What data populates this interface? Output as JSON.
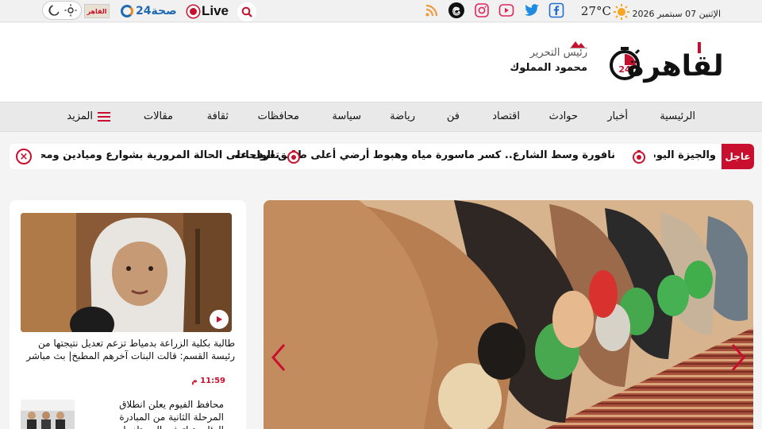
{
  "topbar": {
    "date": "الإثنين 07 سبتمبر 2026",
    "temperature": "27°C",
    "live_label": "Live",
    "sehha_label": "صحة24",
    "mini_logo_text": "القاهر"
  },
  "header": {
    "editor_title": "رئيس التحرير",
    "editor_name": "محمود المملوك",
    "logo_text": "القاهرة",
    "logo_number": "24"
  },
  "nav": {
    "items": [
      "الرئيسية",
      "أخبار",
      "حوادث",
      "اقتصاد",
      "فن",
      "رياضة",
      "سياسة",
      "محافظات",
      "ثقافة",
      "مقالات"
    ],
    "more_label": "المزيد"
  },
  "ticker": {
    "breaking_label": "عاجل",
    "items": [
      "نافورة وسط الشارع.. كسر ماسورة مياه وهبوط أرضي أعلى طريق الواحات",
      "تعرف على الحالة المرورية بشوارع وميادين ومحاور القاهرة والجيزة اليوم"
    ],
    "close_label": "×"
  },
  "sidebar": {
    "articles": [
      {
        "title": "طالبة بكلية الزراعة بدمياط تزعم تعديل نتيجتها من رئيسة القسم: قالت البنات آخرهم المطبخ| بث مباشر",
        "time": "11:59 م"
      },
      {
        "title": "محافظ الفيوم يعلن انطلاق المرحلة الثانية من المبادرة الرئاسية لتوفير المستلزمات الدراسية للطلاب الأولى"
      }
    ]
  },
  "colors": {
    "brand_red": "#c8102e",
    "nav_bg": "#e9e9e9"
  }
}
